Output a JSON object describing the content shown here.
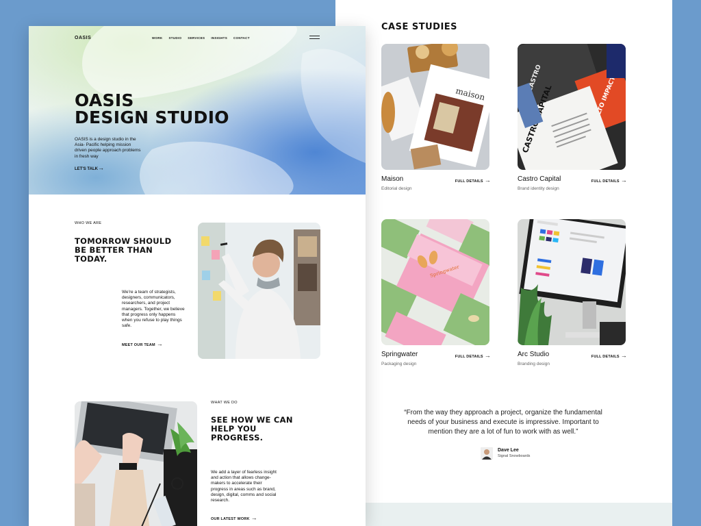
{
  "nav": {
    "logo": "OASIS",
    "links": [
      "WORK",
      "STUDIO",
      "SERVICES",
      "INSIGHTS",
      "CONTACT"
    ]
  },
  "hero": {
    "title_line1": "OASIS",
    "title_line2": "DESIGN STUDIO",
    "description": "OASIS is a design studio in the Asia- Pacific helping mission driven people approach problems in fresh way",
    "cta": "LET'S TALK"
  },
  "who": {
    "label": "WHO WE ARE",
    "heading_line1": "TOMORROW SHOULD",
    "heading_line2": "BE BETTER THAN",
    "heading_line3": "TODAY.",
    "body": "We're a team of strategists, designers, communicators, researchers, and project managers. Together, we believe that progress only happens when you refuse to play things safe.",
    "link": "MEET OUR TEAM"
  },
  "what": {
    "label": "WHAT WE DO",
    "heading_line1": "SEE HOW WE CAN",
    "heading_line2": "HELP YOU",
    "heading_line3": "PROGRESS.",
    "body": "We add a layer of fearless insight and action that allows change-makers to accelerate their progress in areas such as brand, design, digital, comms and social research.",
    "link": "OUR LATEST WORK"
  },
  "case_studies": {
    "title": "CASE STUDIES",
    "details_label": "FULL DETAILS",
    "items": [
      {
        "name": "Maison",
        "category": "Editorial design"
      },
      {
        "name": "Castro Capital",
        "category": "Brand identity design"
      },
      {
        "name": "Springwater",
        "category": "Packaging design"
      },
      {
        "name": "Arc Studio",
        "category": "Branding design"
      }
    ]
  },
  "testimonial": {
    "quote": "“From the way they approach a project, organize the fundamental needs of your business and execute is impressive. Important to mention they are a lot of fun to work with as well.”",
    "author": "Dave Lee",
    "company": "Signal Snowboards"
  },
  "imagery": {
    "maison_magazine": "maison",
    "castro_poster": "CASTRO CAPITAL",
    "castro_alto": "ALTO IMPACTO EN TIEMPO",
    "spring_box": "Springwater"
  },
  "colors": {
    "background": "#6b9bcc",
    "panel": "#ffffff",
    "footer_band": "#e9f0f0",
    "hero_blue": "#5b8fd6",
    "hero_green": "#cfe8b8"
  },
  "icons": [
    "menu-icon",
    "arrow-right-icon"
  ]
}
